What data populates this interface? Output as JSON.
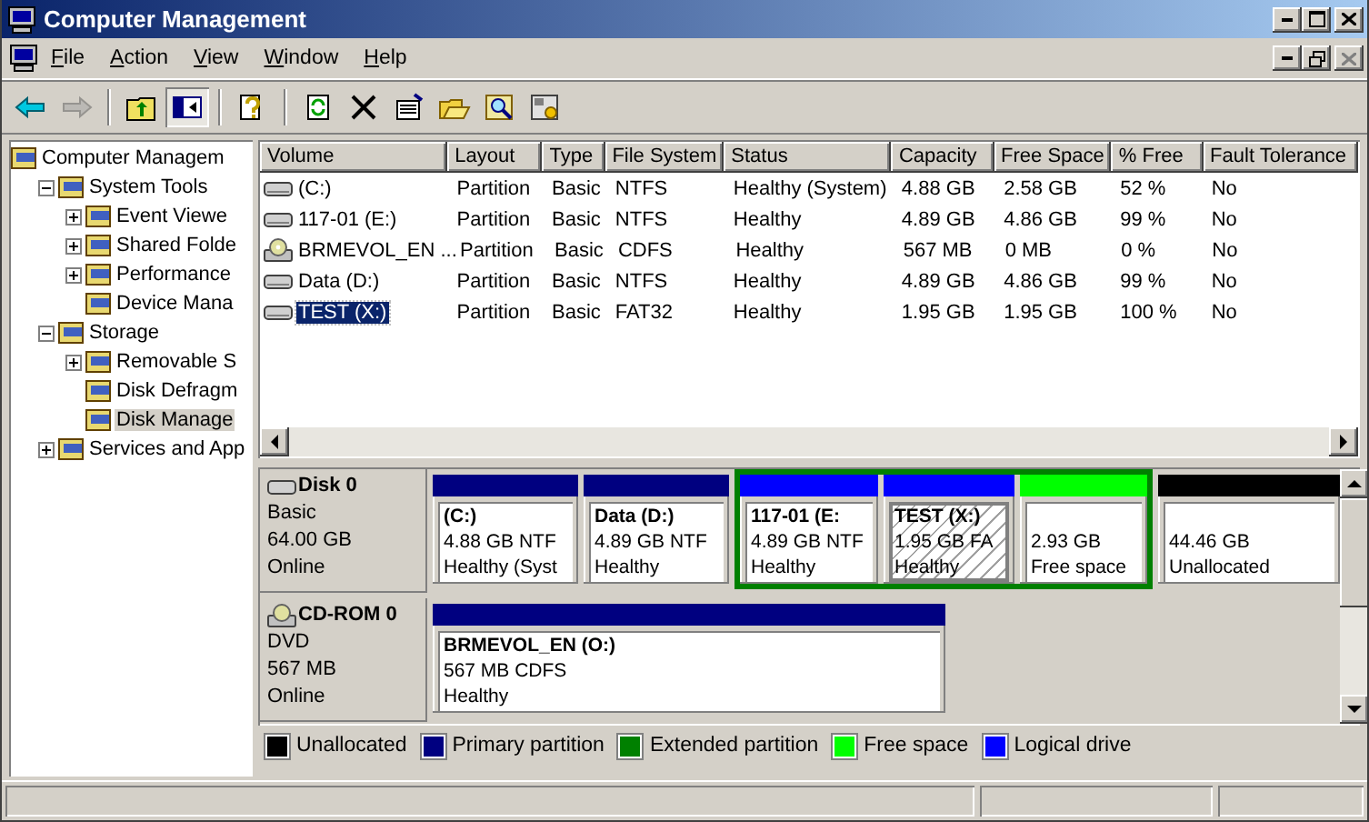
{
  "window": {
    "title": "Computer Management"
  },
  "menu": [
    "File",
    "Action",
    "View",
    "Window",
    "Help"
  ],
  "toolbar": [
    [
      {
        "disabled": false,
        "pressed": false
      },
      {
        "disabled": true,
        "pressed": false
      }
    ],
    [
      {
        "disabled": false,
        "pressed": false
      },
      {
        "disabled": false,
        "pressed": true
      }
    ],
    [
      {
        "disabled": false,
        "pressed": false
      }
    ],
    [
      {
        "disabled": false,
        "pressed": false
      },
      {
        "disabled": false,
        "pressed": false
      },
      {
        "disabled": false,
        "pressed": false
      },
      {
        "disabled": false,
        "pressed": false
      },
      {
        "disabled": false,
        "pressed": false
      },
      {
        "disabled": false,
        "pressed": false
      }
    ]
  ],
  "tree": [
    {
      "label": "Computer Managem",
      "selected": false,
      "children": [
        {
          "label": "System Tools",
          "expanded": true,
          "selected": false,
          "children": [
            {
              "label": "Event Viewe",
              "expanded": false,
              "selected": false
            },
            {
              "label": "Shared Folde",
              "expanded": false,
              "selected": false
            },
            {
              "label": "Performance",
              "expanded": false,
              "selected": false
            },
            {
              "label": "Device Mana",
              "selected": false
            }
          ]
        },
        {
          "label": "Storage",
          "expanded": true,
          "selected": false,
          "children": [
            {
              "label": "Removable S",
              "expanded": false,
              "selected": false
            },
            {
              "label": "Disk Defragm",
              "selected": false
            },
            {
              "label": "Disk Manage",
              "selected": true
            }
          ]
        },
        {
          "label": "Services and App",
          "expanded": false,
          "selected": false
        }
      ]
    }
  ],
  "table": {
    "columns": [
      "Volume",
      "Layout",
      "Type",
      "File System",
      "Status",
      "Capacity",
      "Free Space",
      "% Free",
      "Fault Tolerance"
    ],
    "rows": [
      {
        "kind": "disk",
        "selected": false,
        "cells": [
          "(C:)",
          "Partition",
          "Basic",
          "NTFS",
          "Healthy (System)",
          "4.88 GB",
          "2.58 GB",
          "52 %",
          "No"
        ]
      },
      {
        "kind": "disk",
        "selected": false,
        "cells": [
          "117-01 (E:)",
          "Partition",
          "Basic",
          "NTFS",
          "Healthy",
          "4.89 GB",
          "4.86 GB",
          "99 %",
          "No"
        ]
      },
      {
        "kind": "cd",
        "selected": false,
        "cells": [
          "BRMEVOL_EN ...",
          "Partition",
          "Basic",
          "CDFS",
          "Healthy",
          "567 MB",
          "0 MB",
          "0 %",
          "No"
        ]
      },
      {
        "kind": "disk",
        "selected": false,
        "cells": [
          "Data (D:)",
          "Partition",
          "Basic",
          "NTFS",
          "Healthy",
          "4.89 GB",
          "4.86 GB",
          "99 %",
          "No"
        ]
      },
      {
        "kind": "disk",
        "selected": true,
        "cells": [
          "TEST (X:)",
          "Partition",
          "Basic",
          "FAT32",
          "Healthy",
          "1.95 GB",
          "1.95 GB",
          "100 %",
          "No"
        ]
      }
    ]
  },
  "disks": [
    {
      "kind": "disk",
      "name": "Disk 0",
      "type": "Basic",
      "size": "64.00 GB",
      "status": "Online",
      "segments": [
        {
          "kind": "partition",
          "color": "#000080",
          "name": "(C:)",
          "detail": "4.88 GB NTF",
          "state": "Healthy (Syst",
          "selected": false
        },
        {
          "kind": "partition",
          "color": "#000080",
          "name": "Data  (D:)",
          "detail": "4.89 GB NTF",
          "state": "Healthy",
          "selected": false
        },
        {
          "kind": "extended",
          "color": "#008000",
          "children": [
            {
              "kind": "partition",
              "color": "#0000ff",
              "name": "117-01  (E:",
              "detail": "4.89 GB NTF",
              "state": "Healthy",
              "selected": false
            },
            {
              "kind": "partition",
              "color": "#0000ff",
              "name": "TEST  (X:)",
              "detail": "1.95 GB FA",
              "state": "Healthy",
              "selected": true
            },
            {
              "kind": "partition",
              "color": "#00ff00",
              "detail": "2.93 GB",
              "state": "Free space",
              "selected": false
            }
          ]
        },
        {
          "kind": "partition",
          "color": "#000000",
          "detail": "44.46 GB",
          "state": "Unallocated",
          "selected": false
        }
      ]
    },
    {
      "kind": "cd",
      "name": "CD-ROM 0",
      "type": "DVD",
      "size": "567 MB",
      "status": "Online",
      "segments": [
        {
          "kind": "partition",
          "color": "#000080",
          "name": "BRMEVOL_EN  (O:)",
          "detail": "567 MB CDFS",
          "state": "Healthy",
          "selected": false
        }
      ]
    }
  ],
  "legend": [
    {
      "label": "Unallocated",
      "color": "#000000"
    },
    {
      "label": "Primary partition",
      "color": "#000080"
    },
    {
      "label": "Extended partition",
      "color": "#008000"
    },
    {
      "label": "Free space",
      "color": "#00ff00"
    },
    {
      "label": "Logical drive",
      "color": "#0000ff"
    }
  ]
}
